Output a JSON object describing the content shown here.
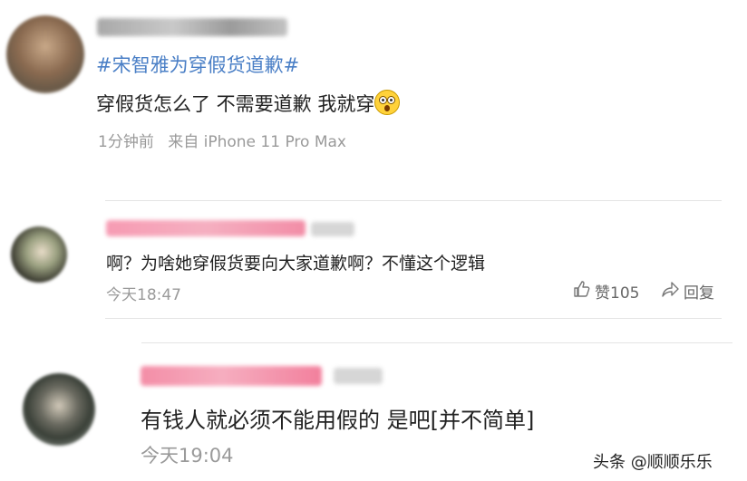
{
  "comment1": {
    "hashtag": "#宋智雅为穿假货道歉#",
    "text": "穿假货怎么了 不需要道歉 我就穿",
    "time": "1分钟前",
    "source": "来自 iPhone 11 Pro Max"
  },
  "reply1": {
    "text": "啊？为啥她穿假货要向大家道歉啊？不懂这个逻辑",
    "time": "今天18:47",
    "like_label": "赞105",
    "reply_label": "回复"
  },
  "reply2": {
    "text": "有钱人就必须不能用假的 是吧[并不简单]",
    "time": "今天19:04"
  },
  "watermark": "头条 @顺顺乐乐",
  "colors": {
    "hashtag": "#4a7fc6",
    "meta": "#9a9a9a",
    "blurred_name": "#f2a0b4"
  }
}
